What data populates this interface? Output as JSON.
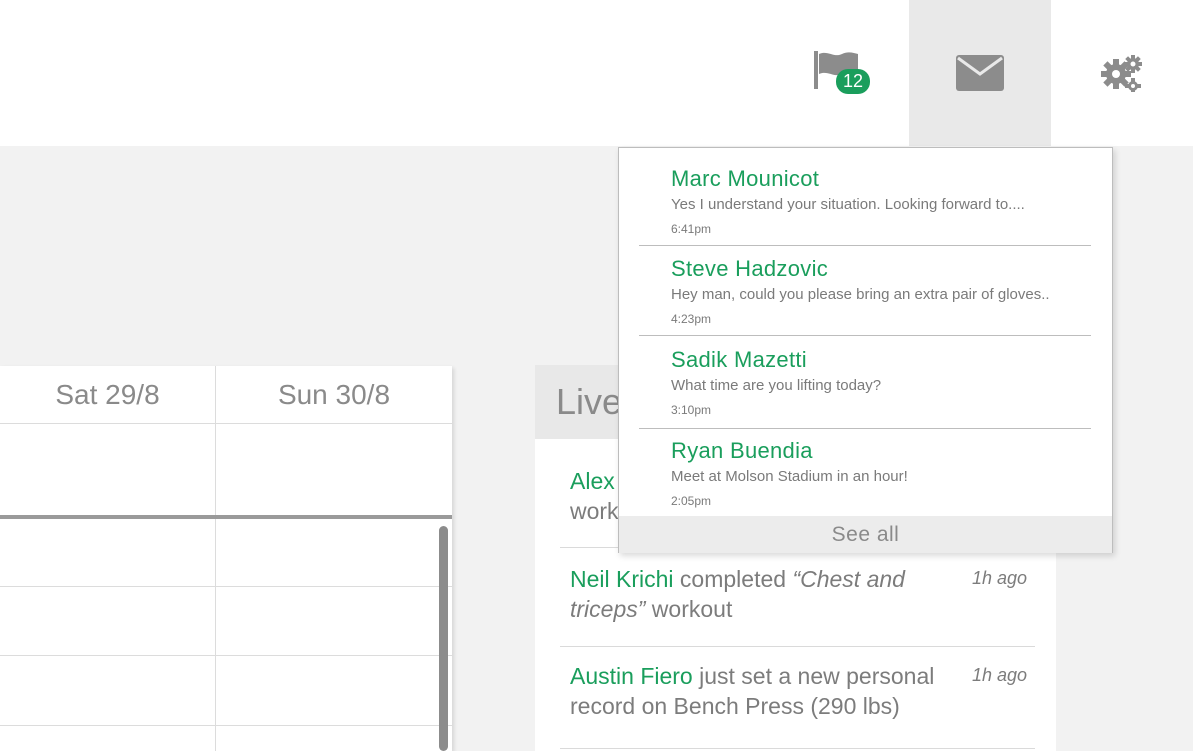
{
  "nav": {
    "flag_badge": "12",
    "icons": [
      "flag-icon",
      "envelope-icon",
      "gears-icon"
    ]
  },
  "calendar": {
    "days": [
      "Sat 29/8",
      "Sun 30/8"
    ]
  },
  "live": {
    "title": "Live",
    "items": [
      {
        "name": "Alex",
        "text": "work",
        "time": ""
      },
      {
        "name": "Neil Krichi",
        "pre": " completed ",
        "em": "“Chest and triceps”",
        "post": " workout",
        "time": "1h ago"
      },
      {
        "name": "Austin Fiero",
        "pre": " just set a new personal record on Bench Press (290 lbs)",
        "time": "1h ago"
      }
    ]
  },
  "messages": {
    "items": [
      {
        "name": "Marc Mounicot",
        "text": "Yes I understand your situation. Looking forward to....",
        "time": "6:41pm"
      },
      {
        "name": "Steve Hadzovic",
        "text": "Hey man, could you please bring an extra pair of gloves..",
        "time": "4:23pm"
      },
      {
        "name": "Sadik Mazetti",
        "text": "What time are you lifting today?",
        "time": "3:10pm"
      },
      {
        "name": "Ryan Buendia",
        "text": "Meet at Molson Stadium in an hour!",
        "time": "2:05pm"
      }
    ],
    "see_all": "See all"
  },
  "colors": {
    "accent": "#1a9e5c",
    "icon": "#8c8c8c",
    "active_nav": "#e9e9e9"
  }
}
